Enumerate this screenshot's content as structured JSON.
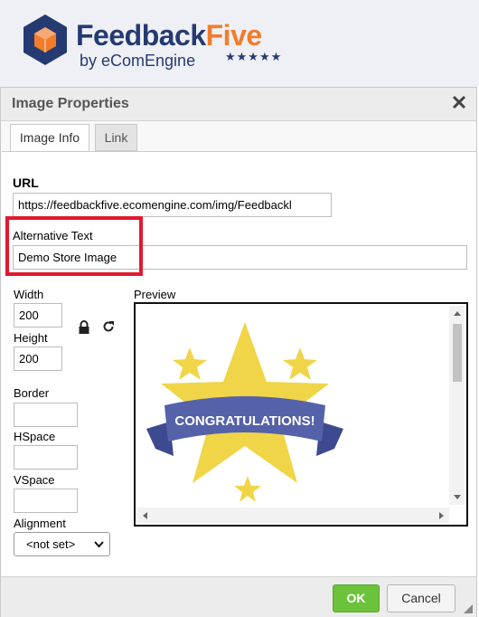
{
  "brand": {
    "name_part1": "Feedback",
    "name_part2": "Five",
    "sub": "by eComEngine",
    "stars": "★★★★★",
    "colors": {
      "navy": "#253a71",
      "orange": "#f37c2b"
    }
  },
  "dialog": {
    "title": "Image Properties",
    "close_icon": "close-icon",
    "tabs": [
      {
        "label": "Image Info",
        "active": true
      },
      {
        "label": "Link",
        "active": false
      }
    ],
    "url": {
      "label": "URL",
      "value": "https://feedbackfive.ecomengine.com/img/Feedbackl"
    },
    "alt_text": {
      "label": "Alternative Text",
      "value": "Demo Store Image"
    },
    "width": {
      "label": "Width",
      "value": "200"
    },
    "height": {
      "label": "Height",
      "value": "200"
    },
    "lock_icon": "lock-icon",
    "reset_icon": "refresh-icon",
    "border": {
      "label": "Border",
      "value": ""
    },
    "hspace": {
      "label": "HSpace",
      "value": ""
    },
    "vspace": {
      "label": "VSpace",
      "value": ""
    },
    "alignment": {
      "label": "Alignment",
      "value": "<not set>"
    },
    "preview": {
      "label": "Preview",
      "banner_text": "CONGRATULATIONS!"
    },
    "buttons": {
      "ok": "OK",
      "cancel": "Cancel"
    },
    "highlight_color": "#e0192f",
    "ok_color": "#6cc23a"
  }
}
